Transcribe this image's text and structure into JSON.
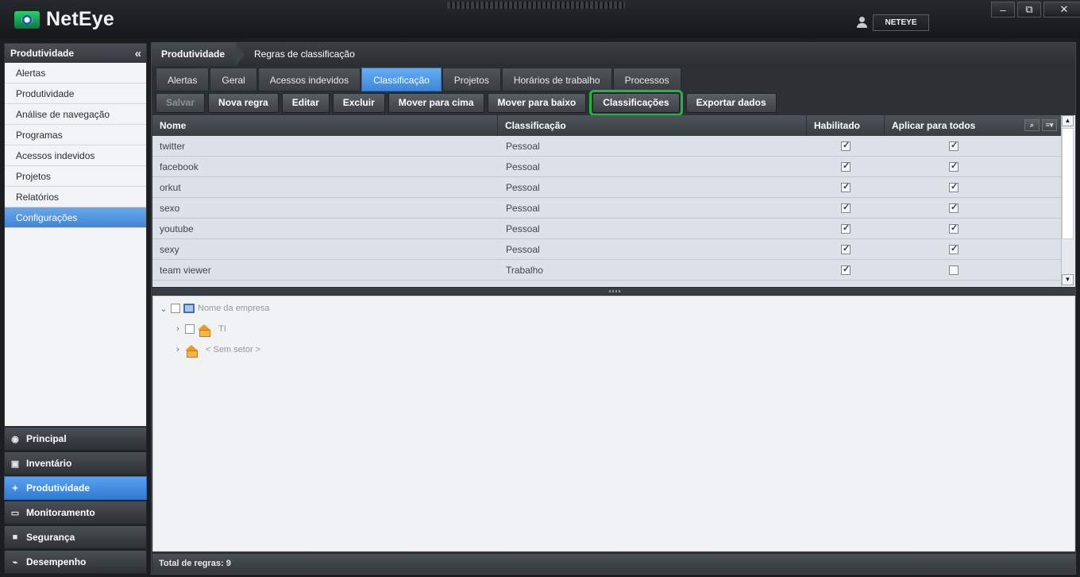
{
  "app": {
    "logo_text": "NetEye",
    "user": "NETEYE",
    "window_controls": [
      "minimize-icon",
      "restore-icon",
      "close-icon"
    ]
  },
  "sidebar": {
    "title": "Produtividade",
    "collapse_symbol": "«",
    "items": [
      {
        "label": "Alertas"
      },
      {
        "label": "Produtividade"
      },
      {
        "label": "Análise de navegação"
      },
      {
        "label": "Programas"
      },
      {
        "label": "Acessos indevidos"
      },
      {
        "label": "Projetos"
      },
      {
        "label": "Relatórios"
      },
      {
        "label": "Configurações",
        "active": true
      }
    ],
    "modules": [
      {
        "label": "Principal",
        "icon": "eye-icon"
      },
      {
        "label": "Inventário",
        "icon": "inventory-icon"
      },
      {
        "label": "Produtividade",
        "icon": "runner-icon",
        "active": true
      },
      {
        "label": "Monitoramento",
        "icon": "monitor-icon"
      },
      {
        "label": "Segurança",
        "icon": "lock-icon"
      },
      {
        "label": "Desempenho",
        "icon": "chart-icon"
      }
    ]
  },
  "breadcrumb": {
    "root": "Produtividade",
    "current": "Regras de classificação"
  },
  "tabs": [
    {
      "label": "Alertas"
    },
    {
      "label": "Geral"
    },
    {
      "label": "Acessos indevidos"
    },
    {
      "label": "Classificação",
      "active": true
    },
    {
      "label": "Projetos"
    },
    {
      "label": "Horários de trabalho"
    },
    {
      "label": "Processos"
    }
  ],
  "toolbar": {
    "salvar": "Salvar",
    "nova_regra": "Nova regra",
    "editar": "Editar",
    "excluir": "Excluir",
    "mover_cima": "Mover para cima",
    "mover_baixo": "Mover para baixo",
    "classificacoes": "Classificações",
    "exportar": "Exportar dados"
  },
  "grid": {
    "columns": [
      "Nome",
      "Classificação",
      "Habilitado",
      "Aplicar para todos"
    ],
    "rows": [
      {
        "nome": "twitter",
        "classificacao": "Pessoal",
        "habilitado": true,
        "aplicar": true
      },
      {
        "nome": "facebook",
        "classificacao": "Pessoal",
        "habilitado": true,
        "aplicar": true
      },
      {
        "nome": "orkut",
        "classificacao": "Pessoal",
        "habilitado": true,
        "aplicar": true
      },
      {
        "nome": "sexo",
        "classificacao": "Pessoal",
        "habilitado": true,
        "aplicar": true
      },
      {
        "nome": "youtube",
        "classificacao": "Pessoal",
        "habilitado": true,
        "aplicar": true
      },
      {
        "nome": "sexy",
        "classificacao": "Pessoal",
        "habilitado": true,
        "aplicar": true
      },
      {
        "nome": "team viewer",
        "classificacao": "Trabalho",
        "habilitado": true,
        "aplicar": false
      }
    ]
  },
  "tree": {
    "root": "Nome da empresa",
    "children": [
      {
        "label": "TI"
      },
      {
        "label": "< Sem setor >"
      }
    ]
  },
  "footer": {
    "total_label": "Total de regras: 9"
  },
  "colors": {
    "accent": "#3f86d6",
    "highlight_outline": "#1fb83d"
  }
}
